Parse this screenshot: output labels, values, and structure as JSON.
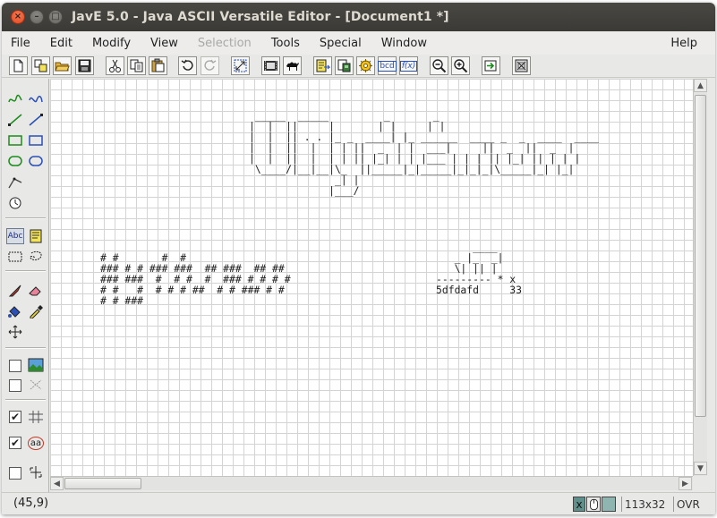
{
  "window": {
    "title": "JavE 5.0 - Java ASCII Versatile Editor - [Document1 *]",
    "close_glyph": "×",
    "minimize_glyph": "–",
    "maximize_glyph": "□"
  },
  "menu": {
    "file": "File",
    "edit": "Edit",
    "modify": "Modify",
    "view": "View",
    "selection": "Selection",
    "tools": "Tools",
    "special": "Special",
    "window": "Window",
    "help": "Help"
  },
  "toolbar": {
    "font_label": "bcd",
    "function_label": "f(x)"
  },
  "palette": {
    "text_tool_label": "Abc",
    "checkbox_checked": "✔",
    "wrap_label": "aa"
  },
  "canvas": {
    "art_title": " _____  _____         _       _\n|  |  ||     |       | |     | |\n|  |  || . . |_ _  ____| |_ ______  ____ _  _  ____  ____\n|  |  ||  |  | | ||  _  | |  ___|     ||  _  ||  _  |\n|  |  ||  |  | | || |_| | | |___ | | | || |_| || | | |\n \\____/|__|__|\\_  ||_____|_|_____|_|_|_|\\_____|_| |_|\n              _| |\n             |___/",
    "art_hash": "# #       #  #\n### # # ### ###  ## ###  ## ##\n### ###  #  # #  #  ### # # # #\n# #   #  # # # ##  # # ### # #\n# # ###",
    "art_small": "      ____\n   _ |_  _|\n   \\| || |\n--------- * x\n5dfdafd     33"
  },
  "status": {
    "coords": "(45,9)",
    "ind_x": "x",
    "size": "113x32",
    "mode": "OVR"
  }
}
